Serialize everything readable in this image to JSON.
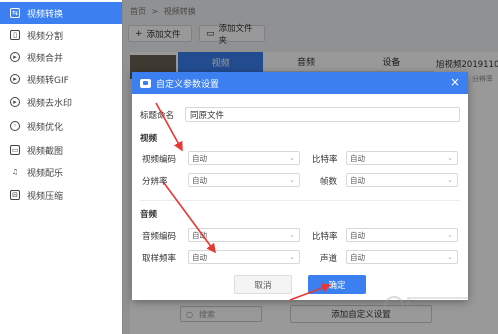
{
  "sidebar": {
    "items": [
      {
        "label": "视频转换",
        "icon": "convert-icon",
        "active": true
      },
      {
        "label": "视频分割",
        "icon": "split-icon"
      },
      {
        "label": "视频合并",
        "icon": "merge-icon"
      },
      {
        "label": "视频转GIF",
        "icon": "gif-icon"
      },
      {
        "label": "视频去水印",
        "icon": "watermark-remove-icon"
      },
      {
        "label": "视频优化",
        "icon": "optimize-icon"
      },
      {
        "label": "视频截图",
        "icon": "screenshot-icon"
      },
      {
        "label": "视频配乐",
        "icon": "music-icon"
      },
      {
        "label": "视频压缩",
        "icon": "compress-icon"
      }
    ]
  },
  "breadcrumb": {
    "home": "首页",
    "separator": ">",
    "current": "视频转换"
  },
  "toolbar": {
    "add_file": "添加文件",
    "add_folder": "添加文件夹"
  },
  "format_tabs": [
    "视频",
    "音频",
    "设备"
  ],
  "file_name": "旭视频2019110...",
  "file_sub": "分辨率",
  "search": {
    "placeholder": "搜索"
  },
  "add_custom_button": "添加自定义设置",
  "dialog": {
    "title": "自定义参数设置",
    "close": "×",
    "name_label": "标题命名",
    "name_value": "同原文件",
    "video_section": "视频",
    "video_codec_label": "视频编码",
    "video_codec_value": "自动",
    "bitrate_label": "比特率",
    "bitrate_value": "自动",
    "resolution_label": "分辨率",
    "resolution_value": "自动",
    "framerate_label": "帧数",
    "framerate_value": "自动",
    "audio_section": "音频",
    "audio_codec_label": "音频编码",
    "audio_codec_value": "自动",
    "audio_bitrate_label": "比特率",
    "audio_bitrate_value": "自动",
    "samplerate_label": "取样频率",
    "samplerate_value": "自动",
    "channel_label": "声道",
    "channel_value": "自动",
    "cancel": "取消",
    "ok": "确定"
  },
  "colors": {
    "accent": "#3b7ff0",
    "annotation": "#e53935"
  }
}
